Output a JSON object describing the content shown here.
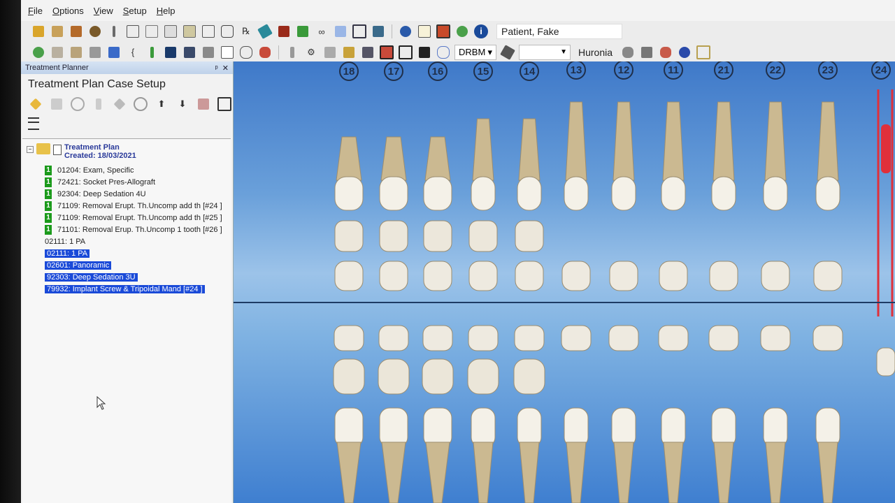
{
  "menu": [
    "File",
    "Options",
    "View",
    "Setup",
    "Help"
  ],
  "toolbar1": {
    "patient_name": "Patient, Fake"
  },
  "toolbar2": {
    "chart_mode": "DRBM",
    "location": "Huronia"
  },
  "panel": {
    "title": "Treatment Planner",
    "heading": "Treatment Plan Case Setup",
    "plan_title": "Treatment Plan",
    "plan_created": "Created: 18/03/2021",
    "phase_items": [
      {
        "phase": "1",
        "text": "01204: Exam, Specific"
      },
      {
        "phase": "1",
        "text": "72421: Socket Pres-Allograft"
      },
      {
        "phase": "1",
        "text": "92304: Deep Sedation 4U"
      },
      {
        "phase": "1",
        "text": "71109: Removal Erupt. Th.Uncomp add th [#24 ]"
      },
      {
        "phase": "1",
        "text": "71109: Removal Erupt. Th.Uncomp add th [#25 ]"
      },
      {
        "phase": "1",
        "text": "71101: Removal Erup. Th.Uncomp 1 tooth [#26 ]"
      }
    ],
    "plain_item": "02111: 1 PA",
    "selected_items": [
      "02111: 1 PA",
      "02601: Panoramic",
      "92303: Deep Sedation 3U",
      "79932: Implant Screw & Tripoidal Mand [#24 ]"
    ]
  },
  "tooth_numbers": [
    "18",
    "17",
    "16",
    "15",
    "14",
    "13",
    "12",
    "11",
    "21",
    "22",
    "23",
    "24"
  ]
}
